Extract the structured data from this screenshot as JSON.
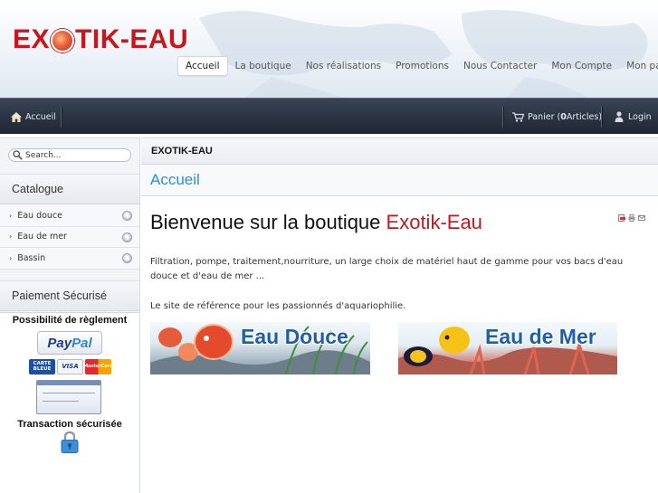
{
  "header": {
    "logo_text": "EXOTIK-EAU",
    "nav": [
      {
        "label": "Accueil",
        "active": true
      },
      {
        "label": "La boutique"
      },
      {
        "label": "Nos réalisations"
      },
      {
        "label": "Promotions"
      },
      {
        "label": "Nous Contacter"
      },
      {
        "label": "Mon Compte"
      },
      {
        "label": "Mon panier"
      }
    ]
  },
  "toolbar": {
    "home_label": "Accueil",
    "cart_prefix": "Panier (",
    "cart_count": "0",
    "cart_suffix": " Articles)",
    "login_label": "Login"
  },
  "sidebar": {
    "search_placeholder": "Search...",
    "catalogue_heading": "Catalogue",
    "categories": [
      {
        "label": "Eau douce"
      },
      {
        "label": "Eau de mer"
      },
      {
        "label": "Bassin"
      }
    ],
    "payment_heading": "Paiement Sécurisé",
    "payment_options_title": "Possibilité de règlement",
    "paypal_text_1": "Pay",
    "paypal_text_2": "Pal",
    "card_cb": "CARTE BLEUE",
    "card_visa": "VISA",
    "card_mc": "MasterCard",
    "secure_title": "Transaction sécurisée"
  },
  "main": {
    "title": "EXOTIK-EAU",
    "breadcrumb": "Accueil",
    "welcome_prefix": "Bienvenue sur la boutique ",
    "welcome_brand": "Exotik-Eau",
    "intro": "Filtration, pompe, traitement,nourriture, un large choix de matériel haut de gamme pour vos bacs d'eau douce et d'eau de mer ...",
    "reference": "Le site de référence pour les passionnés d'aquariophilie.",
    "banner_douce": "Eau Douce",
    "banner_mer": "Eau de Mer"
  },
  "colors": {
    "brand_red": "#c8161d",
    "link_blue": "#2b8fd6",
    "toolbar_dark": "#1f2633"
  },
  "icons": [
    "home-icon",
    "cart-icon",
    "user-icon",
    "search-icon",
    "plus-icon",
    "pdf-icon",
    "print-icon",
    "email-icon",
    "lock-icon"
  ]
}
